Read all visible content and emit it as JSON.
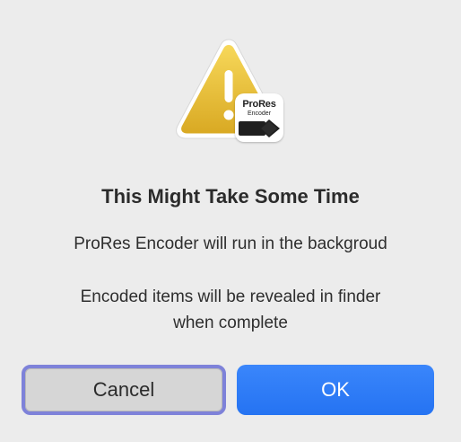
{
  "dialog": {
    "title": "This Might Take Some Time",
    "message_line1": "ProRes Encoder will run in the backgroud",
    "message_line2a": "Encoded items will be revealed in finder",
    "message_line2b": "when complete"
  },
  "icon": {
    "name": "warning-triangle-icon",
    "color": "#f0c93c"
  },
  "app_badge": {
    "name": "prores-encoder-app-icon",
    "line1": "ProRes",
    "line2": "Encoder"
  },
  "buttons": {
    "cancel_label": "Cancel",
    "ok_label": "OK",
    "ok_color": "#2f7cf6",
    "focus_ring_color": "#7e82d9"
  }
}
